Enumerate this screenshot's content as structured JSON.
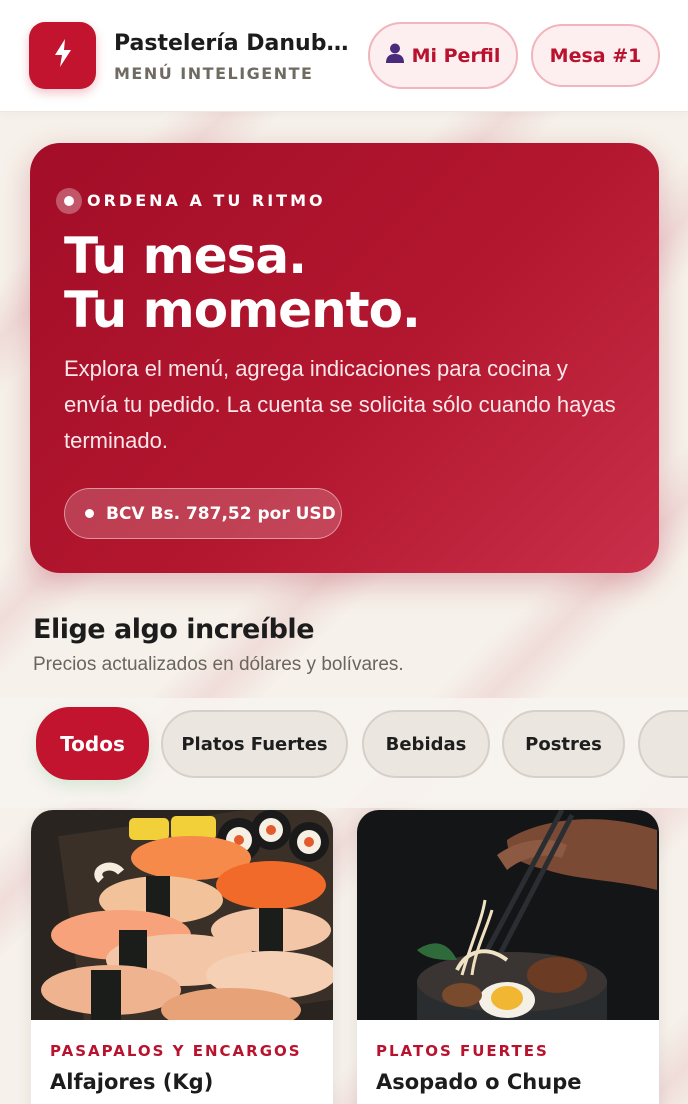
{
  "header": {
    "brand_name": "Pastelería Danub...",
    "brand_subtitle": "MENÚ INTELIGENTE",
    "logo_icon": "lightning-bolt-icon",
    "profile_button": "Mi Perfil",
    "profile_icon": "user-icon",
    "table_button": "Mesa #1"
  },
  "hero": {
    "eyebrow": "ORDENA A TU RITMO",
    "title_line1": "Tu mesa.",
    "title_line2": "Tu momento.",
    "description": "Explora el menú, agrega indicaciones para cocina y envía tu pedido. La cuenta se solicita sólo cuando hayas terminado.",
    "exchange_rate": "BCV Bs. 787,52 por USD"
  },
  "section": {
    "title": "Elige algo increíble",
    "subtitle": "Precios actualizados en dólares y bolívares."
  },
  "tabs": [
    {
      "label": "Todos",
      "active": true
    },
    {
      "label": "Platos Fuertes",
      "active": false
    },
    {
      "label": "Bebidas",
      "active": false
    },
    {
      "label": "Postres",
      "active": false
    },
    {
      "label": "",
      "active": false
    }
  ],
  "products": [
    {
      "category": "PASAPALOS Y ENCARGOS",
      "name": "Alfajores (Kg)"
    },
    {
      "category": "PLATOS FUERTES",
      "name": "Asopado o Chupe"
    }
  ],
  "colors": {
    "accent": "#c2142f",
    "accent_soft": "#fdeff0",
    "background": "#f6f2ec"
  }
}
